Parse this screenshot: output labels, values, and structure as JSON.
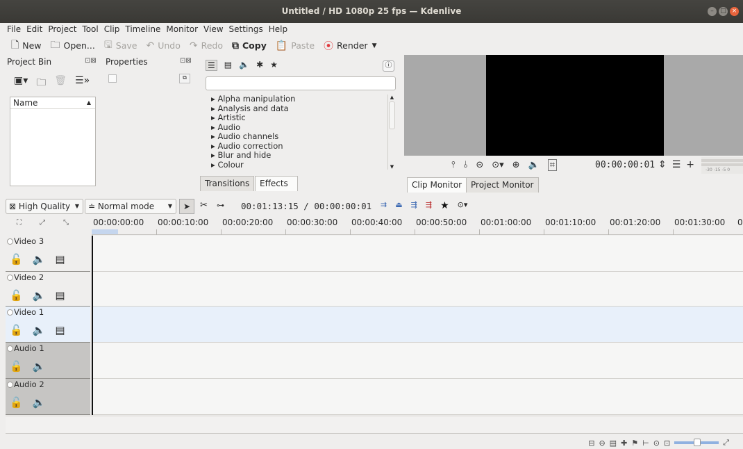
{
  "window": {
    "title": "Untitled / HD 1080p 25 fps — Kdenlive",
    "min": "–",
    "max": "□",
    "close": "×"
  },
  "menu": [
    "File",
    "Edit",
    "Project",
    "Tool",
    "Clip",
    "Timeline",
    "Monitor",
    "View",
    "Settings",
    "Help"
  ],
  "toolbar": {
    "new": "New",
    "open": "Open...",
    "save": "Save",
    "undo": "Undo",
    "redo": "Redo",
    "copy": "Copy",
    "paste": "Paste",
    "render": "Render"
  },
  "icons": {
    "new": "page-icon",
    "open": "folder-icon",
    "save": "floppy-icon",
    "undo": "undo-icon",
    "redo": "redo-icon",
    "copy": "copy-icon",
    "paste": "paste-icon",
    "render": "record-icon"
  },
  "project_bin": {
    "title": "Project Bin",
    "column": "Name"
  },
  "properties": {
    "title": "Properties"
  },
  "effects": {
    "search_value": "",
    "items": [
      "Alpha manipulation",
      "Analysis and data",
      "Artistic",
      "Audio",
      "Audio channels",
      "Audio correction",
      "Blur and hide",
      "Colour"
    ],
    "tabs": [
      "Transitions",
      "Effects"
    ]
  },
  "monitor": {
    "timecode": "00:00:00:01",
    "tabs": [
      "Clip Monitor",
      "Project Monitor"
    ],
    "meter_scale": "-30 -15 -5 0"
  },
  "timeline_toolbar": {
    "quality": "High Quality",
    "mode": "Normal mode",
    "position": "00:01:13:15 / 00:00:00:01"
  },
  "ruler": [
    "00:00:00:00",
    "00:00:10:00",
    "00:00:20:00",
    "00:00:30:00",
    "00:00:40:00",
    "00:00:50:00",
    "00:01:00:00",
    "00:01:10:00",
    "00:01:20:00",
    "00:01:30:00",
    "0"
  ],
  "tracks": [
    {
      "name": "Video 3",
      "type": "video"
    },
    {
      "name": "Video 2",
      "type": "video"
    },
    {
      "name": "Video 1",
      "type": "video"
    },
    {
      "name": "Audio 1",
      "type": "audio"
    },
    {
      "name": "Audio 2",
      "type": "audio"
    }
  ],
  "colors": {
    "titlebar": "#3e3d39",
    "selected_track": "#e8f0fa",
    "audio_track_header": "#c6c5c3",
    "close_button": "#e8643c"
  }
}
